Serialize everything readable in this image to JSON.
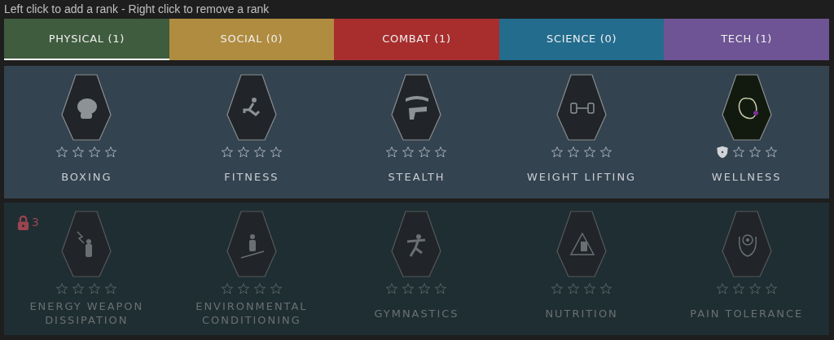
{
  "hint": "Left click to add a rank - Right click to remove a rank",
  "tabs": [
    {
      "label": "PHYSICAL (1)",
      "selected": true,
      "color": "#3f5c3e"
    },
    {
      "label": "SOCIAL (0)",
      "selected": false,
      "color": "#b08c40"
    },
    {
      "label": "COMBAT (1)",
      "selected": false,
      "color": "#a82e2e"
    },
    {
      "label": "SCIENCE (0)",
      "selected": false,
      "color": "#236c8d"
    },
    {
      "label": "TECH (1)",
      "selected": false,
      "color": "#6e5494"
    }
  ],
  "tiers": [
    {
      "locked": false,
      "skills": [
        {
          "name": "BOXING",
          "stars": 0,
          "selected": false
        },
        {
          "name": "FITNESS",
          "stars": 0,
          "selected": false
        },
        {
          "name": "STEALTH",
          "stars": 0,
          "selected": false
        },
        {
          "name": "WEIGHT LIFTING",
          "stars": 0,
          "selected": false
        },
        {
          "name": "WELLNESS",
          "stars": 1,
          "selected": true
        }
      ]
    },
    {
      "locked": true,
      "requirement": "3",
      "skills": [
        {
          "name": "ENERGY WEAPON DISSIPATION",
          "stars": 0,
          "selected": false
        },
        {
          "name": "ENVIRONMENTAL CONDITIONING",
          "stars": 0,
          "selected": false
        },
        {
          "name": "GYMNASTICS",
          "stars": 0,
          "selected": false
        },
        {
          "name": "NUTRITION",
          "stars": 0,
          "selected": false
        },
        {
          "name": "PAIN TOLERANCE",
          "stars": 0,
          "selected": false
        }
      ]
    }
  ]
}
